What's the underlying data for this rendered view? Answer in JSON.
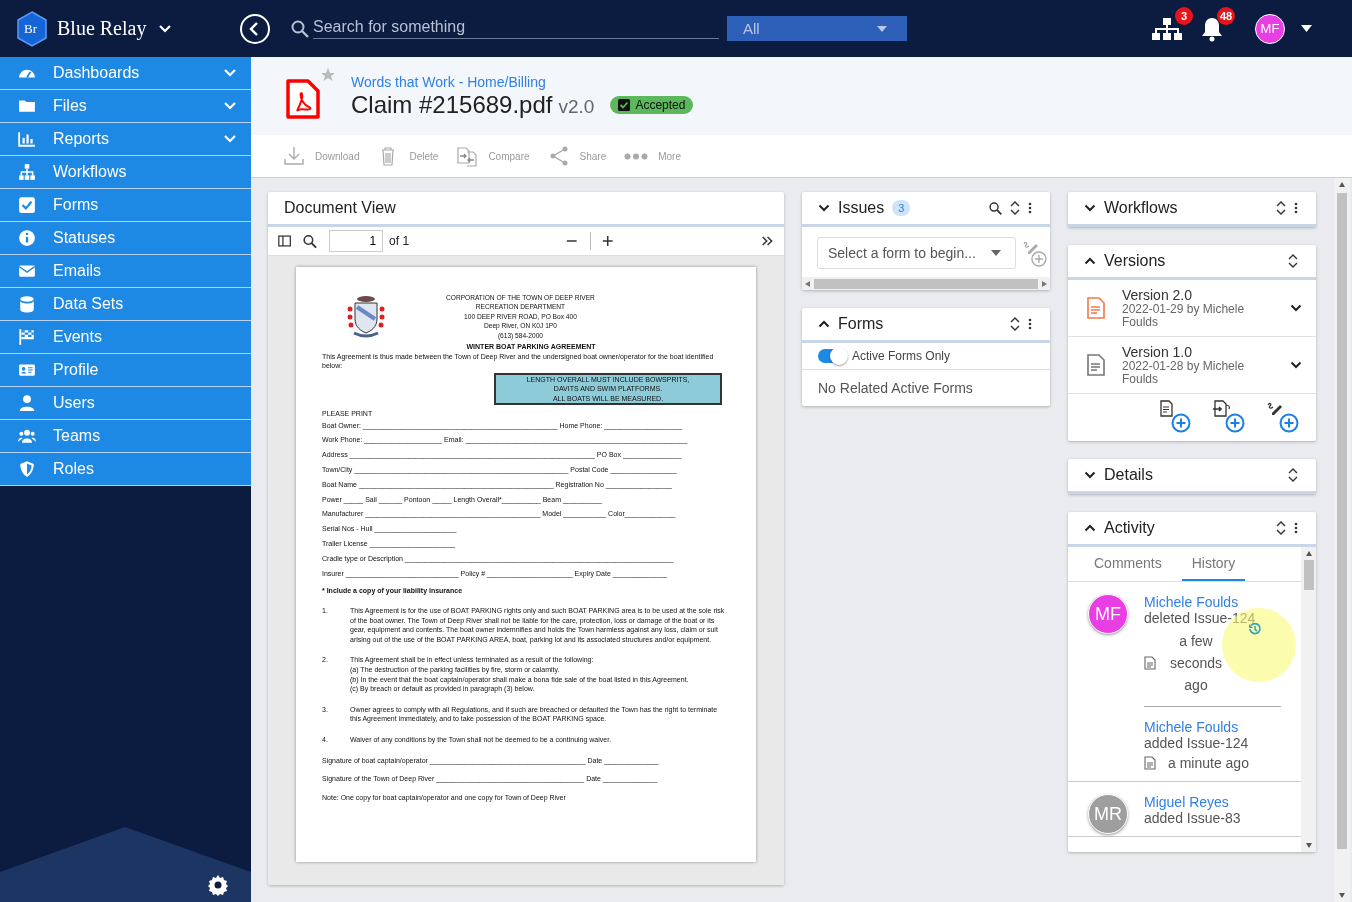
{
  "topbar": {
    "logo_text": "Br",
    "app_name": "Blue Relay",
    "search": {
      "placeholder": "Search for something"
    },
    "scope": "All",
    "network_count": "3",
    "notification_count": "48",
    "avatar": "MF"
  },
  "sidebar": {
    "items": [
      {
        "label": "Dashboards",
        "expandable": true
      },
      {
        "label": "Files",
        "expandable": true
      },
      {
        "label": "Reports",
        "expandable": true
      },
      {
        "label": "Workflows",
        "expandable": false
      },
      {
        "label": "Forms",
        "expandable": false
      },
      {
        "label": "Statuses",
        "expandable": false
      },
      {
        "label": "Emails",
        "expandable": false
      },
      {
        "label": "Data Sets",
        "expandable": false
      },
      {
        "label": "Events",
        "expandable": false
      },
      {
        "label": "Profile",
        "expandable": false
      },
      {
        "label": "Users",
        "expandable": false
      },
      {
        "label": "Teams",
        "expandable": false
      },
      {
        "label": "Roles",
        "expandable": false
      }
    ]
  },
  "header": {
    "breadcrumb": "Words that Work - Home/Billing",
    "title": "Claim #215689.pdf",
    "version": "v2.0",
    "status": "Accepted",
    "favorite": false
  },
  "actions": [
    "Download",
    "Delete",
    "Compare",
    "Share",
    "More"
  ],
  "document_view": {
    "title": "Document View",
    "page": "1",
    "page_total": "of 1",
    "document": {
      "org_lines": [
        "CORPORATION OF THE TOWN OF DEEP RIVER",
        "RECREATION DEPARTMENT",
        "100 DEEP RIVER ROAD, PO Box 400",
        "Deep River, ON   K0J 1P0",
        "(613) 584-2000"
      ],
      "title": "WINTER BOAT PARKING AGREEMENT",
      "intro": "This Agreement is thus made between the Town of Deep River and the undersigned boat owner/operator for the boat identified below:",
      "notice": [
        "LENGTH OVERALL MUST INCLUDE BOWSPRITS,",
        "DAVITS AND SWIM PLATFORMS.",
        "ALL BOATS WILL BE MEASURED."
      ],
      "print_label": "PLEASE PRINT",
      "fields": [
        "Boat Owner: __________________________________________________ Home Phone: ____________________",
        "Work Phone: ____________________ Email: _________________________________________________________",
        "Address _______________________________________________________________ PO Box _______________",
        "Town/City _______________________________________________________ Postal Code _________________",
        "Boat Name __________________________________________________ Registration No _________________",
        "Power _____ Sail ______ Pontoon _____ Length Overall*__________ Beam __________",
        "Manufacturer _____________________________________________ Model ___________ Color_____________",
        "Serial Nos - Hull _____________________",
        "Trailer License ______________________",
        "Cradle type or Description _____________________________________________________________________",
        "Insurer _____________________________ Policy # ______________________   Expiry Date ______________"
      ],
      "insurance_note": "* Include a copy of your liability insurance",
      "clauses": [
        {
          "number": "1.",
          "lines": [
            "This Agreement is for the use of BOAT PARKING rights only and such BOAT PARKING area is to be used at the sole risk of the boat owner. The Town of Deep River shall not be liable for the care, protection, loss or damage of the boat or its gear, equipment and contents. The boat owner indemnifies and holds the Town harmless against any loss, claim or suit arising out of the use of the BOAT PARKING AREA, boat, parking lot and its associated structures and/or equipment."
          ]
        },
        {
          "number": "2.",
          "lines": [
            "This Agreement shall be in effect unless terminated as a result of the following:",
            "(a) The destruction of the parking facilities by fire, storm or calamity.",
            "(b) In the event that the boat captain/operator shall make a bona fide sale of the boat listed in this Agreement.",
            "(c) By breach or default as provided in paragraph (3) below."
          ]
        },
        {
          "number": "3.",
          "lines": [
            "Owner agrees to comply with all Regulations, and if such are breached or defaulted the Town has the right to terminate this Agreement immediately, and to take possession of the BOAT PARKING space."
          ]
        },
        {
          "number": "4.",
          "lines": [
            "Waiver of any conditions by the Town shall not be deemed to be a continuing waiver."
          ]
        }
      ],
      "signatures": [
        "Signature of boat captain/operator ________________________________________ Date ______________",
        "Signature of the Town of Deep River ______________________________________ Date ______________"
      ],
      "note": "Note: One copy for boat captain/operator and one copy for Town of Deep River"
    }
  },
  "issues": {
    "title": "Issues",
    "count": "3",
    "expanded": false,
    "select_placeholder": "Select a form to begin..."
  },
  "forms": {
    "title": "Forms",
    "expanded": true,
    "toggle": {
      "label": "Active Forms Only",
      "on": true
    },
    "empty_text": "No Related Active Forms"
  },
  "workflows": {
    "title": "Workflows",
    "expanded": false
  },
  "versions": {
    "title": "Versions",
    "expanded": true,
    "items": [
      {
        "name": "Version 2.0",
        "meta": "2022-01-29 by Michele Foulds",
        "current": true
      },
      {
        "name": "Version 1.0",
        "meta": "2022-01-28 by Michele Foulds",
        "current": false
      }
    ]
  },
  "details": {
    "title": "Details",
    "expanded": false
  },
  "activity": {
    "title": "Activity",
    "expanded": true,
    "tabs": [
      {
        "label": "Comments",
        "selected": false
      },
      {
        "label": "History",
        "selected": true
      }
    ],
    "groups": [
      {
        "initials": "MF",
        "color": "#e83ee3",
        "events": [
          {
            "user": "Michele Foulds",
            "action": "deleted Issue-124",
            "time": "a few seconds ago",
            "highlighted": true
          },
          {
            "user": "Michele Foulds",
            "action": "added Issue-124",
            "time": "a minute ago",
            "highlighted": false
          }
        ]
      },
      {
        "initials": "MR",
        "color": "#9e9e9e",
        "events": [
          {
            "user": "Miguel Reyes",
            "action": "added Issue-83",
            "highlighted": false
          }
        ]
      }
    ]
  }
}
